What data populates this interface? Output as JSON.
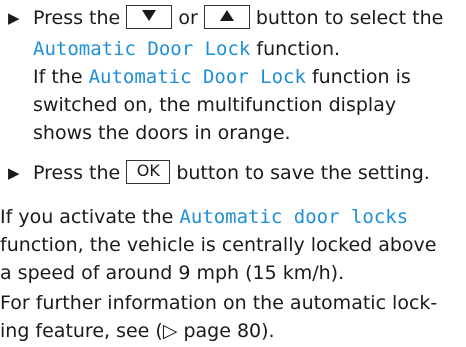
{
  "step1": {
    "press": "Press the",
    "or": "or",
    "button_to_select": "button to select the",
    "function_name": "Automatic Door Lock",
    "function_suffix": "function.",
    "if_the": "If the",
    "function_name2": "Automatic Door Lock",
    "function_is": "function is",
    "line3": "switched on, the multifunction display",
    "line4": "shows the doors in orange."
  },
  "step2": {
    "press": "Press the",
    "ok_label": "OK",
    "suffix": "button to save the setting."
  },
  "para1": {
    "prefix": "If you activate the",
    "function_name": "Automatic door locks",
    "line2": "function, the vehicle is centrally locked above",
    "line3": "a speed of around 9 mph (15 km/h)."
  },
  "para2": {
    "line1": "For further information on the automatic lock-",
    "line2": "ing feature, see (▷ page 80)."
  },
  "icons": {
    "bullet": "bullet-triangle-icon",
    "down": "down-arrow-icon",
    "up": "up-arrow-icon"
  },
  "colors": {
    "highlight": "#1f8fd6"
  }
}
